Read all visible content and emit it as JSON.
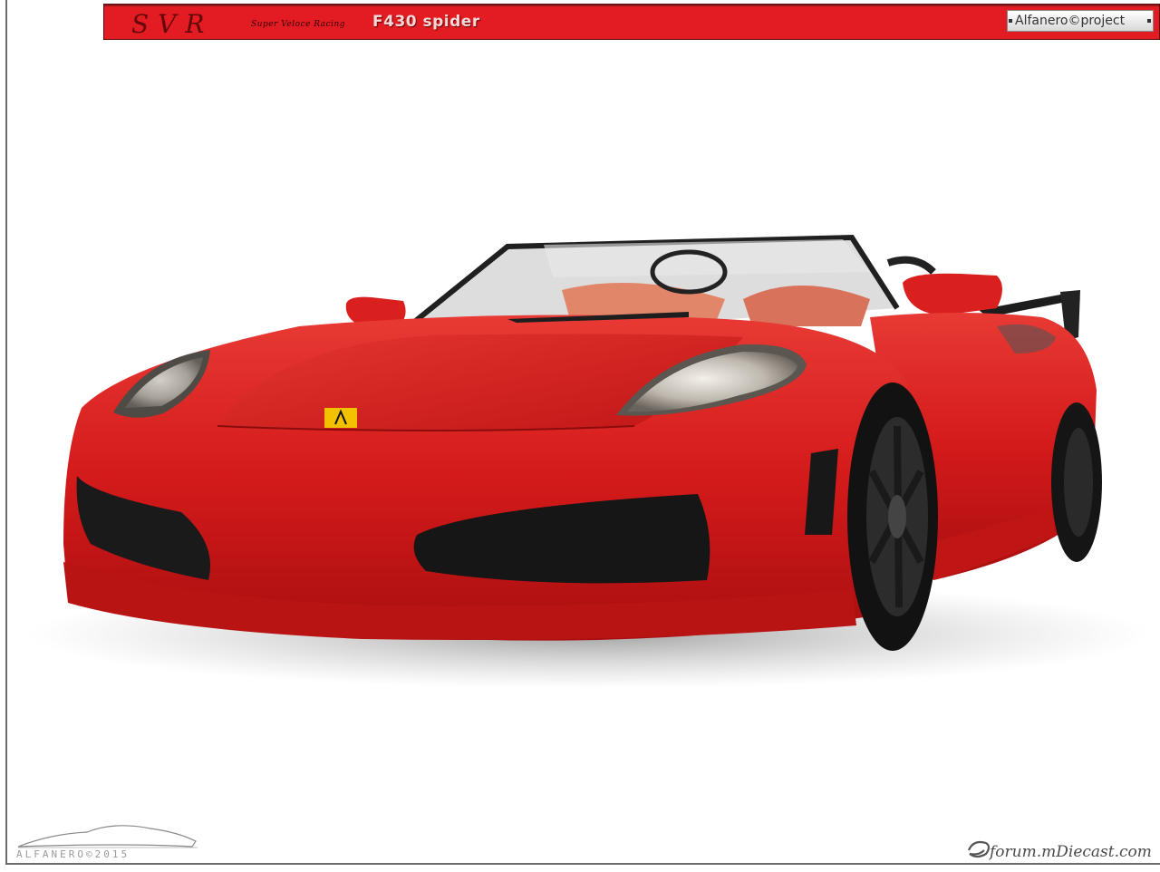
{
  "header": {
    "logo_text": "SVR",
    "logo_tagline": "Super Veloce Racing",
    "model_title": "F430 spider",
    "credit": "Alfanero©project"
  },
  "watermarks": {
    "left": "ALFANERO©2015",
    "right": "forum.mDiecast.com"
  },
  "photo": {
    "subject": "red-convertible-model-car",
    "colors": {
      "body": "#d81c1c",
      "bar": "#e21c22",
      "wheels": "#1a1a1a"
    }
  }
}
